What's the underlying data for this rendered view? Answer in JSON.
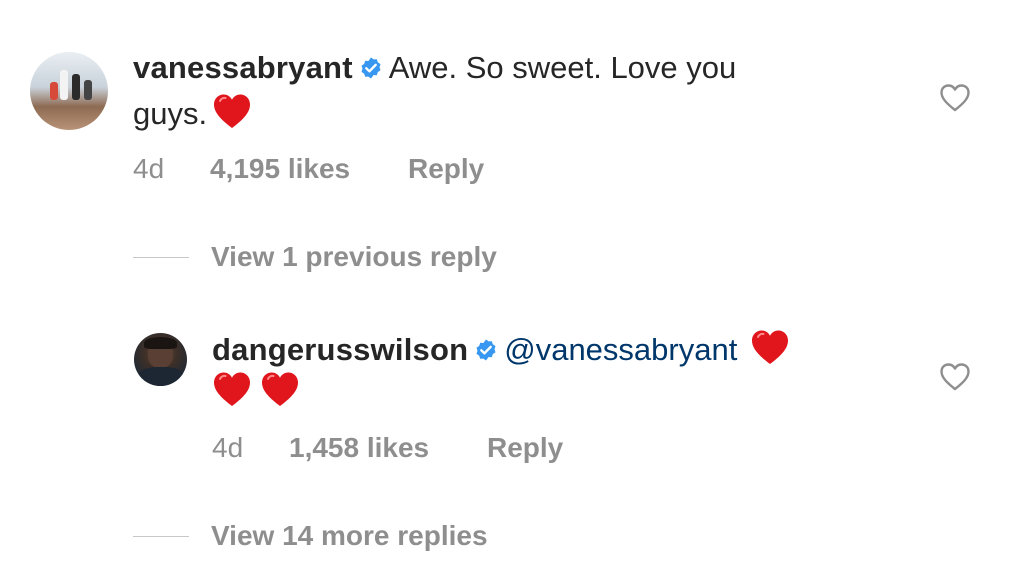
{
  "comments": [
    {
      "username": "vanessabryant",
      "verified": true,
      "text_line1": "Awe. So sweet. Love you",
      "text_line2": "guys.",
      "emoji": "red-heart",
      "time": "4d",
      "likes": "4,195 likes",
      "reply_label": "Reply",
      "view_replies": "View 1 previous reply"
    },
    {
      "username": "dangerusswilson",
      "verified": true,
      "mention": "@vanessabryant",
      "emoji": "red-heart",
      "emoji_count": 3,
      "time": "4d",
      "likes": "1,458 likes",
      "reply_label": "Reply",
      "view_replies": "View 14 more replies"
    }
  ],
  "colors": {
    "text": "#262626",
    "muted": "#8e8e8e",
    "mention": "#00376b",
    "verified": "#3897f0",
    "heart": "#e0161c"
  },
  "icons": {
    "verified": "verified-badge-icon",
    "like": "heart-outline-icon",
    "emoji": "red-heart-emoji"
  }
}
